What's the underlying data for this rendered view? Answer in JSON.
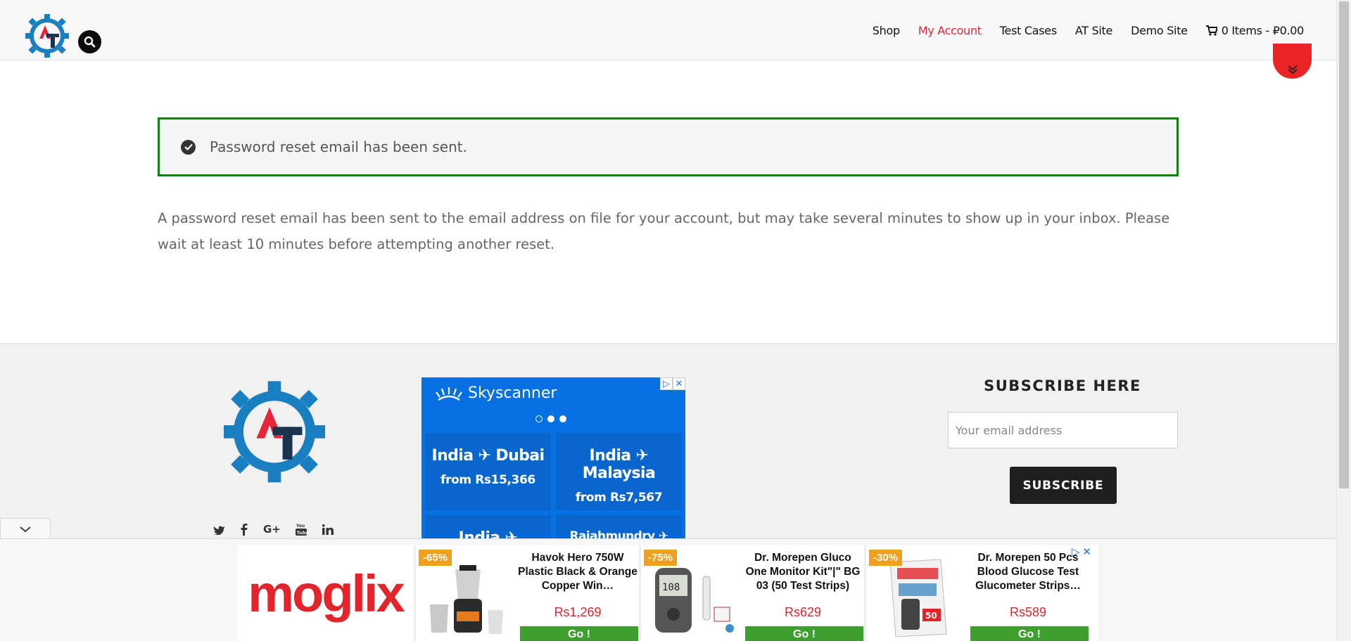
{
  "header": {
    "nav": [
      {
        "label": "Shop",
        "active": false
      },
      {
        "label": "My Account",
        "active": true
      },
      {
        "label": "Test Cases",
        "active": false
      },
      {
        "label": "AT Site",
        "active": false
      },
      {
        "label": "Demo Site",
        "active": false
      }
    ],
    "cart_label": "0 Items - ₽0.00"
  },
  "notice": {
    "message": "Password reset email has been sent."
  },
  "body_text": "A password reset email has been sent to the email address on file for your account, but may take several minutes to show up in your inbox. Please wait at least 10 minutes before attempting another reset.",
  "footer": {
    "skyscanner_ad": {
      "brand": "Skyscanner",
      "cards": [
        {
          "dest": "India ✈ Dubai",
          "price": "from Rs15,366"
        },
        {
          "dest": "India ✈ Malaysia",
          "price": "from Rs7,567"
        },
        {
          "dest": "India ✈ Thailand",
          "price": ""
        },
        {
          "dest": "Rajahmundry ✈ Goa",
          "price": ""
        }
      ]
    },
    "subscribe": {
      "title": "SUBSCRIBE HERE",
      "email_placeholder": "Your email address",
      "button_label": "SUBSCRIBE"
    }
  },
  "ad_bar": {
    "brand": "moglix",
    "products": [
      {
        "badge": "-65%",
        "title": "Havok Hero 750W Plastic Black & Orange Copper Win…",
        "price": "Rs1,269",
        "cta": "Go !"
      },
      {
        "badge": "-75%",
        "title": "Dr. Morepen Gluco One Monitor Kit\"|\" BG 03 (50 Test Strips)",
        "price": "Rs629",
        "cta": "Go !"
      },
      {
        "badge": "-30%",
        "title": "Dr. Morepen 50 Pcs Blood Glucose Test Glucometer Strips…",
        "price": "Rs589",
        "cta": "Go !"
      }
    ]
  },
  "colors": {
    "accent_red": "#e6243a",
    "success_green": "#118111",
    "skyscanner_blue": "#0770e3",
    "go_green": "#3e9e2e"
  },
  "icons": {
    "search": "search-icon",
    "cart": "cart-icon",
    "check": "check-circle-icon",
    "scroll": "double-chevron-down-icon",
    "social": [
      "twitter-icon",
      "facebook-icon",
      "google-plus-icon",
      "youtube-icon",
      "linkedin-icon"
    ]
  }
}
